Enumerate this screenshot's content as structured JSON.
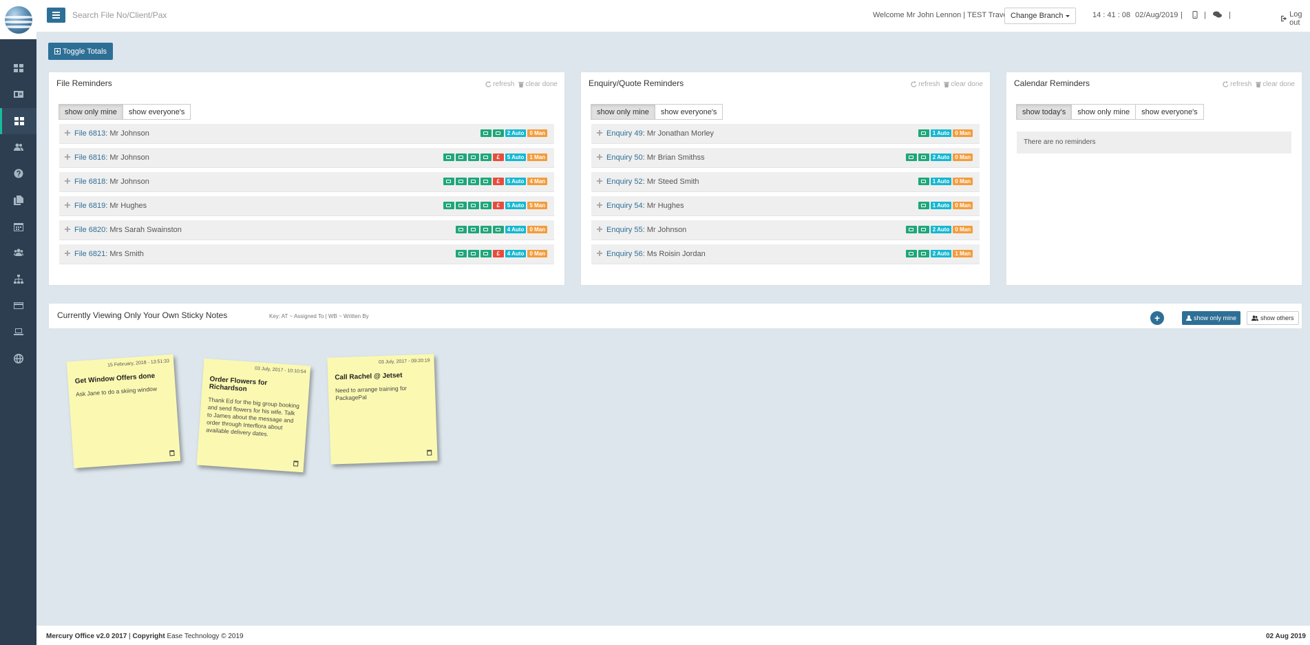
{
  "topbar": {
    "search_placeholder": "Search File No/Client/Pax",
    "welcome": "Welcome Mr John Lennon | TEST Travel |",
    "change_branch": "Change Branch",
    "time": "14 : 41 : 08",
    "date": "02/Aug/2019",
    "sep": "|",
    "logout": "Log out"
  },
  "toggle_totals": "Toggle Totals",
  "file_reminders": {
    "title": "File Reminders",
    "refresh": "refresh",
    "clear_done": "clear done",
    "filters": [
      "show only mine",
      "show everyone's"
    ],
    "rows": [
      {
        "link": "File 6813",
        "who": ": Mr Johnson",
        "badges": [
          [
            "g",
            ""
          ],
          [
            "g",
            ""
          ],
          [
            "t",
            "2 Auto"
          ],
          [
            "o",
            "0 Man"
          ]
        ]
      },
      {
        "link": "File 6816",
        "who": ": Mr Johnson",
        "badges": [
          [
            "g",
            ""
          ],
          [
            "g",
            ""
          ],
          [
            "g",
            ""
          ],
          [
            "g",
            ""
          ],
          [
            "r",
            "£"
          ],
          [
            "t",
            "5 Auto"
          ],
          [
            "o",
            "1 Man"
          ]
        ]
      },
      {
        "link": "File 6818",
        "who": ": Mr Johnson",
        "badges": [
          [
            "g",
            ""
          ],
          [
            "g",
            ""
          ],
          [
            "g",
            ""
          ],
          [
            "g",
            ""
          ],
          [
            "r",
            "£"
          ],
          [
            "t",
            "5 Auto"
          ],
          [
            "o",
            "4 Man"
          ]
        ]
      },
      {
        "link": "File 6819",
        "who": ": Mr Hughes",
        "badges": [
          [
            "g",
            ""
          ],
          [
            "g",
            ""
          ],
          [
            "g",
            ""
          ],
          [
            "g",
            ""
          ],
          [
            "r",
            "£"
          ],
          [
            "t",
            "5 Auto"
          ],
          [
            "o",
            "5 Man"
          ]
        ]
      },
      {
        "link": "File 6820",
        "who": ": Mrs Sarah Swainston",
        "badges": [
          [
            "g",
            ""
          ],
          [
            "g",
            ""
          ],
          [
            "g",
            ""
          ],
          [
            "g",
            ""
          ],
          [
            "t",
            "4 Auto"
          ],
          [
            "o",
            "0 Man"
          ]
        ]
      },
      {
        "link": "File 6821",
        "who": ": Mrs Smith",
        "badges": [
          [
            "g",
            ""
          ],
          [
            "g",
            ""
          ],
          [
            "g",
            ""
          ],
          [
            "r",
            "£"
          ],
          [
            "t",
            "4 Auto"
          ],
          [
            "o",
            "0 Man"
          ]
        ]
      }
    ]
  },
  "enquiry_reminders": {
    "title": "Enquiry/Quote Reminders",
    "refresh": "refresh",
    "clear_done": "clear done",
    "filters": [
      "show only mine",
      "show everyone's"
    ],
    "rows": [
      {
        "link": "Enquiry 49",
        "who": ": Mr Jonathan Morley",
        "badges": [
          [
            "g",
            ""
          ],
          [
            "t",
            "1 Auto"
          ],
          [
            "o",
            "0 Man"
          ]
        ]
      },
      {
        "link": "Enquiry 50",
        "who": ": Mr Brian Smithss",
        "badges": [
          [
            "g",
            ""
          ],
          [
            "g",
            ""
          ],
          [
            "t",
            "2 Auto"
          ],
          [
            "o",
            "0 Man"
          ]
        ]
      },
      {
        "link": "Enquiry 52",
        "who": ": Mr Steed Smith",
        "badges": [
          [
            "g",
            ""
          ],
          [
            "t",
            "1 Auto"
          ],
          [
            "o",
            "0 Man"
          ]
        ]
      },
      {
        "link": "Enquiry 54",
        "who": ": Mr Hughes",
        "badges": [
          [
            "g",
            ""
          ],
          [
            "t",
            "1 Auto"
          ],
          [
            "o",
            "0 Man"
          ]
        ]
      },
      {
        "link": "Enquiry 55",
        "who": ": Mr Johnson",
        "badges": [
          [
            "g",
            ""
          ],
          [
            "g",
            ""
          ],
          [
            "t",
            "2 Auto"
          ],
          [
            "o",
            "0 Man"
          ]
        ]
      },
      {
        "link": "Enquiry 56",
        "who": ": Ms Roisin Jordan",
        "badges": [
          [
            "g",
            ""
          ],
          [
            "g",
            ""
          ],
          [
            "t",
            "2 Auto"
          ],
          [
            "o",
            "1 Man"
          ]
        ]
      }
    ]
  },
  "calendar_reminders": {
    "title": "Calendar Reminders",
    "refresh": "refresh",
    "clear_done": "clear done",
    "filters": [
      "show today's",
      "show only mine",
      "show everyone's"
    ],
    "empty": "There are no reminders"
  },
  "sticky": {
    "title": "Currently Viewing Only Your Own Sticky Notes",
    "key": "Key: AT ~ Assigned To | WB ~ Written By",
    "add": "+",
    "show_only_mine": "show only mine",
    "show_others": "show others",
    "notes": [
      {
        "timestamp": "15 February, 2018 - 13:51:33",
        "title": "Get Window Offers done",
        "body": "Ask Jane to do a skiing window"
      },
      {
        "timestamp": "03 July, 2017 - 10:10:54",
        "title": "Order Flowers for Richardson",
        "body": "Thank Ed for the big group booking and send flowers for his wife. Talk to James about the message and order through Interflora about available delivery dates."
      },
      {
        "timestamp": "03 July, 2017 - 09:20:19",
        "title": "Call Rachel @ Jetset",
        "body": "Need to arrange training for PackagePal"
      }
    ]
  },
  "footer": {
    "product": "Mercury Office v2.0 2017",
    "sep": " | ",
    "copyright_label": "Copyright",
    "copyright_text": " Ease Technology © 2019",
    "date": "02 Aug 2019"
  },
  "icons": {
    "sidebar": [
      "dashboard-icon",
      "id-card-icon",
      "dashboard-icon",
      "users-icon",
      "help-icon",
      "copy-icon",
      "calendar-icon",
      "group-icon",
      "sitemap-icon",
      "credit-card-icon",
      "laptop-icon",
      "globe-icon"
    ]
  },
  "colors": {
    "primary": "#2e6f96",
    "sidebar": "#2c3e50",
    "accent": "#1abc9c",
    "badge_green": "#1fa67a",
    "badge_teal": "#16b7d0",
    "badge_orange": "#f39c3c",
    "badge_red": "#e74c3c",
    "sticky": "#fbf9b1"
  }
}
